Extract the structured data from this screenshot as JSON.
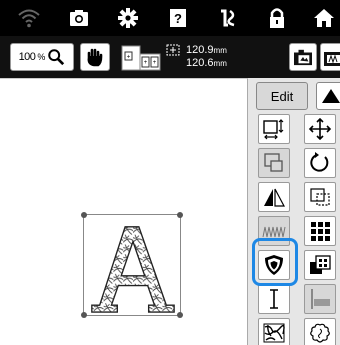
{
  "statusbar": {
    "icons": [
      "wifi-icon",
      "camera-icon",
      "settings-gear-icon",
      "help-icon",
      "thread-icon",
      "lock-icon",
      "home-icon"
    ]
  },
  "toolbar": {
    "zoom_value": "100",
    "zoom_unit": "%",
    "width_value": "120.9",
    "width_unit": "mm",
    "height_value": "120.6",
    "height_unit": "mm"
  },
  "panel": {
    "edit_label": "Edit",
    "tools": [
      "resize-tool",
      "move-tool",
      "group-tool",
      "rotate-tool",
      "mirror-tool",
      "border-tool",
      "density-tool",
      "array-tool",
      "applique-tool",
      "color-tool",
      "text-tool",
      "align-tool",
      "stipple-tool",
      "outline-tool"
    ]
  },
  "design": {
    "letter": "A"
  },
  "colors": {
    "highlight": "#1e88e5",
    "statusbar_bg": "#000000",
    "panel_bg": "#e6e6e6"
  }
}
